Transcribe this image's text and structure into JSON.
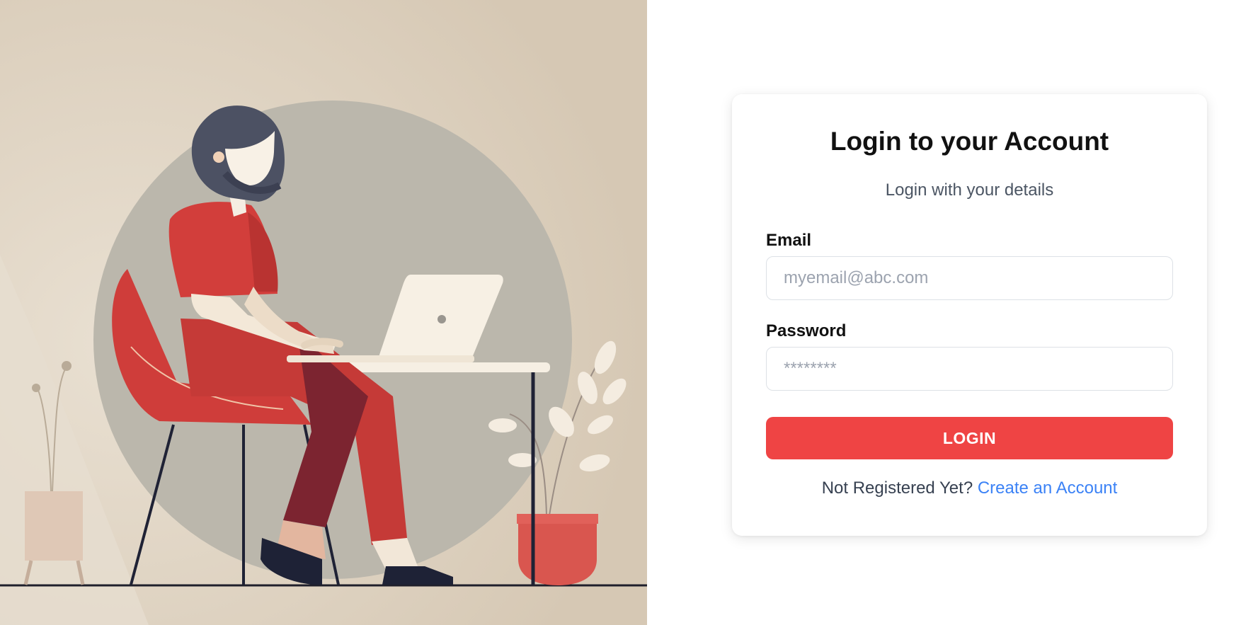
{
  "login": {
    "title": "Login to your Account",
    "subtitle": "Login with your details",
    "email": {
      "label": "Email",
      "value": "",
      "placeholder": "myemail@abc.com"
    },
    "password": {
      "label": "Password",
      "value": "",
      "placeholder": "********"
    },
    "submit_label": "LOGIN",
    "register_prompt": "Not Registered Yet?",
    "register_link_label": "Create an Account"
  },
  "colors": {
    "accent": "#ef4444",
    "link": "#3b82f6",
    "hero_background": "#d8cbb9"
  },
  "hero": {
    "icon": "woman-working-on-laptop-illustration"
  }
}
